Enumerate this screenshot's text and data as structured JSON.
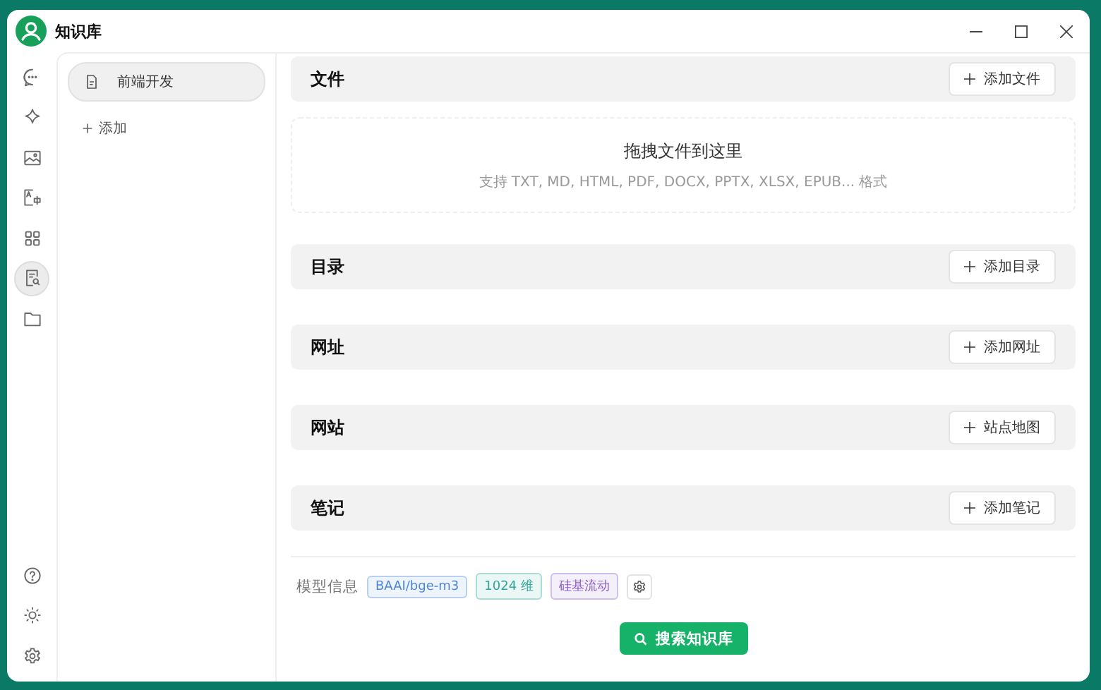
{
  "window": {
    "title": "知识库"
  },
  "nav": {
    "top": [
      {
        "kind": "chat",
        "selected": false
      },
      {
        "kind": "sparkle",
        "selected": false
      },
      {
        "kind": "image",
        "selected": false
      },
      {
        "kind": "translate",
        "selected": false
      },
      {
        "kind": "grid",
        "selected": false
      },
      {
        "kind": "knowledge",
        "selected": true
      },
      {
        "kind": "folder",
        "selected": false
      }
    ],
    "bottom": [
      {
        "kind": "help",
        "selected": false
      },
      {
        "kind": "sun",
        "selected": false
      },
      {
        "kind": "settings",
        "selected": false
      }
    ]
  },
  "sidebar": {
    "items": [
      {
        "label": "前端开发",
        "selected": true
      }
    ],
    "add_label": "添加"
  },
  "sections": [
    {
      "title": "文件",
      "button": "添加文件",
      "dropzone": {
        "title": "拖拽文件到这里",
        "hint": "支持 TXT, MD, HTML, PDF, DOCX, PPTX, XLSX, EPUB... 格式"
      }
    },
    {
      "title": "目录",
      "button": "添加目录"
    },
    {
      "title": "网址",
      "button": "添加网址"
    },
    {
      "title": "网站",
      "button": "站点地图"
    },
    {
      "title": "笔记",
      "button": "添加笔记"
    }
  ],
  "model_info": {
    "label": "模型信息",
    "tags": [
      {
        "text": "BAAI/bge-m3",
        "color": "#4f86d9"
      },
      {
        "text": "1024 维",
        "color": "#2fa89a"
      },
      {
        "text": "硅基流动",
        "color": "#8a5cc7"
      }
    ]
  },
  "search_button": "搜索知识库"
}
